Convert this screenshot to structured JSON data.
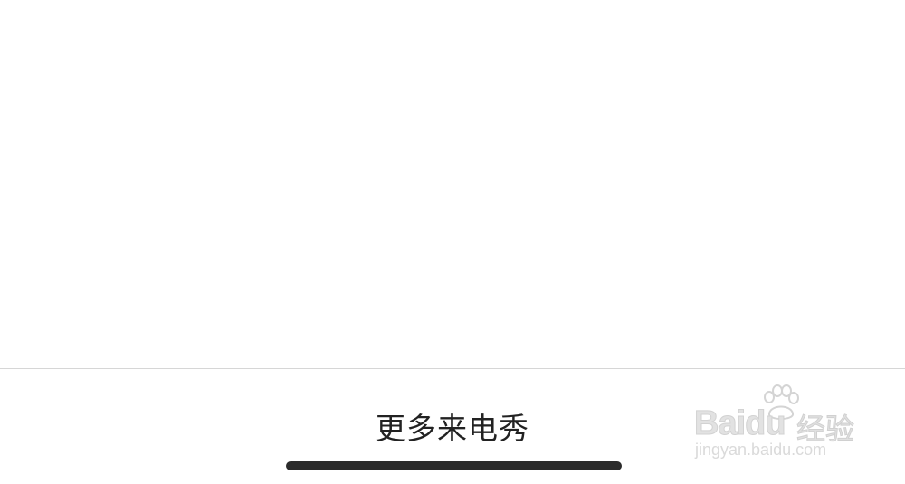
{
  "bottom_bar": {
    "more_label": "更多来电秀"
  },
  "watermark": {
    "logo_text": "Baidu",
    "logo_text_cn": "经验",
    "url": "jingyan.baidu.com"
  },
  "colors": {
    "background": "#ffffff",
    "divider": "#d6d6d6",
    "text": "#222222",
    "home_indicator": "#2b2b2b"
  }
}
